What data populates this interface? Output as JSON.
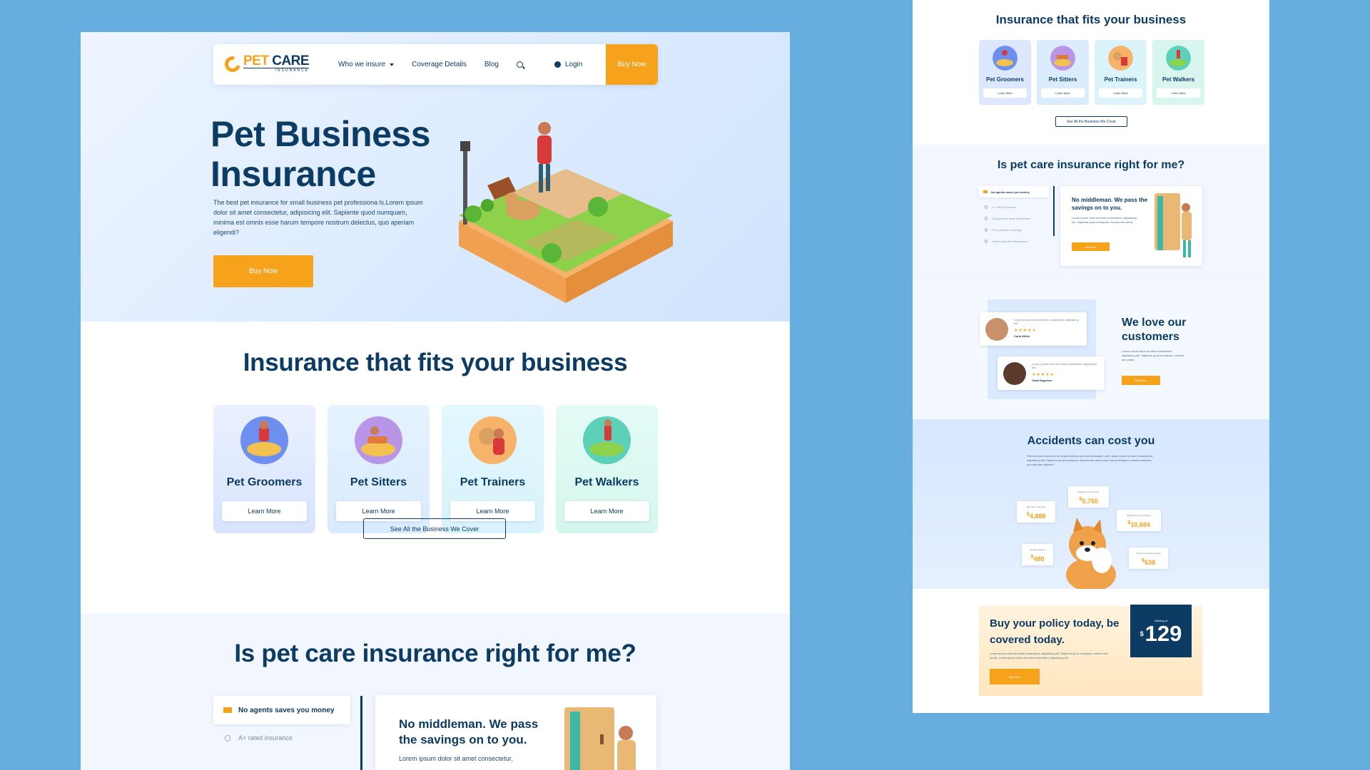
{
  "nav": {
    "logo_pet": "PET",
    "logo_care": " CARE",
    "logo_sub": "INSURANCE",
    "links": [
      "Who we insure",
      "Coverage Details",
      "Blog"
    ],
    "login": "Login",
    "buy": "Buy Now"
  },
  "hero": {
    "title": "Pet Business Insurance",
    "text": "The best pet insurance for small business pet professiona ls.Lorem ipsum dolor sit amet consectetur, adipisicing elit. Sapiente quod numquam, minima est omnis esse harum tempore nostrum delectus, quo aperiam eligendi?",
    "buy": "Buy Now"
  },
  "fits": {
    "title": "Insurance that fits your business",
    "cards": [
      {
        "label": "Pet Groomers",
        "cta": "Learn More"
      },
      {
        "label": "Pet Sitters",
        "cta": "Learn More"
      },
      {
        "label": "Pet Trainers",
        "cta": "Learn More"
      },
      {
        "label": "Pet Walkers",
        "cta": "Learn More"
      }
    ],
    "see_all": "See All the Business We Cover"
  },
  "right_for_me": {
    "title": "Is pet care insurance right for me?",
    "tabs": [
      "No agents saves you money",
      "A+ rated insurance",
      "Designed for small businesses",
      "Pet protection coverage",
      "Veterinarian Reimbursement"
    ],
    "card_title": "No middleman. We pass the savings on to you.",
    "card_text": "Lorem ipsum dolor sit amet consectetur,",
    "card_btn": "Buy Now",
    "card_text_small": "Lorem ipsum dolor sit amet consectetur, adipisicing elit. Sapiente quod numquam, minima est omnis."
  },
  "customers": {
    "title": "We love our customers",
    "text": "Lorem ipsum dolor sit amet consectetur, adipisicing elit. Sapiente quod numquam, minima est omnis.",
    "btn": "Buy Now",
    "reviews": [
      {
        "text": "Lorem ipsum dolor sit amet consectetur, adipisicing elit.",
        "stars": "★★★★★",
        "name": "Carla White"
      },
      {
        "text": "Lorem ipsum dolor sit amet consectetur, adipisicing elit.",
        "stars": "★★★★★",
        "name": "Chad Eagerton"
      }
    ]
  },
  "accidents": {
    "title": "Accidents can cost you",
    "text": "The best pet insurance for small business pet professionals.Lorem ipsum dolor sit amet consectetur, adipisicing elit. Sapiente quod numquam, minima est omnis esse harum tempore nostrum delectus, quo aperiam eligendi?",
    "costs": [
      {
        "label": "Bite from a dog day",
        "value": "4,888"
      },
      {
        "label": "Escape of a client ball",
        "value": "5,750"
      },
      {
        "label": "Broken fine from training",
        "value": "10,684"
      },
      {
        "label": "Allergic reaction",
        "value": "480"
      },
      {
        "label": "Cut from grooming shears",
        "value": "638"
      }
    ],
    "currency": "$"
  },
  "buy_policy": {
    "title": "Buy your policy today, be covered today.",
    "text": "Lorem ipsum dolor sit amet consectetur, adipisicing elit. Sapiente quod numquam, minima est omnis. Lorem ipsum dolor sit amet consectetur, adipisicing elit.",
    "btn": "Buy Now",
    "starting": "Starting at",
    "currency": "$",
    "price": "129"
  },
  "colors": {
    "navy": "#0c3b63",
    "orange": "#f7a21b",
    "backdrop": "#66aee0"
  }
}
